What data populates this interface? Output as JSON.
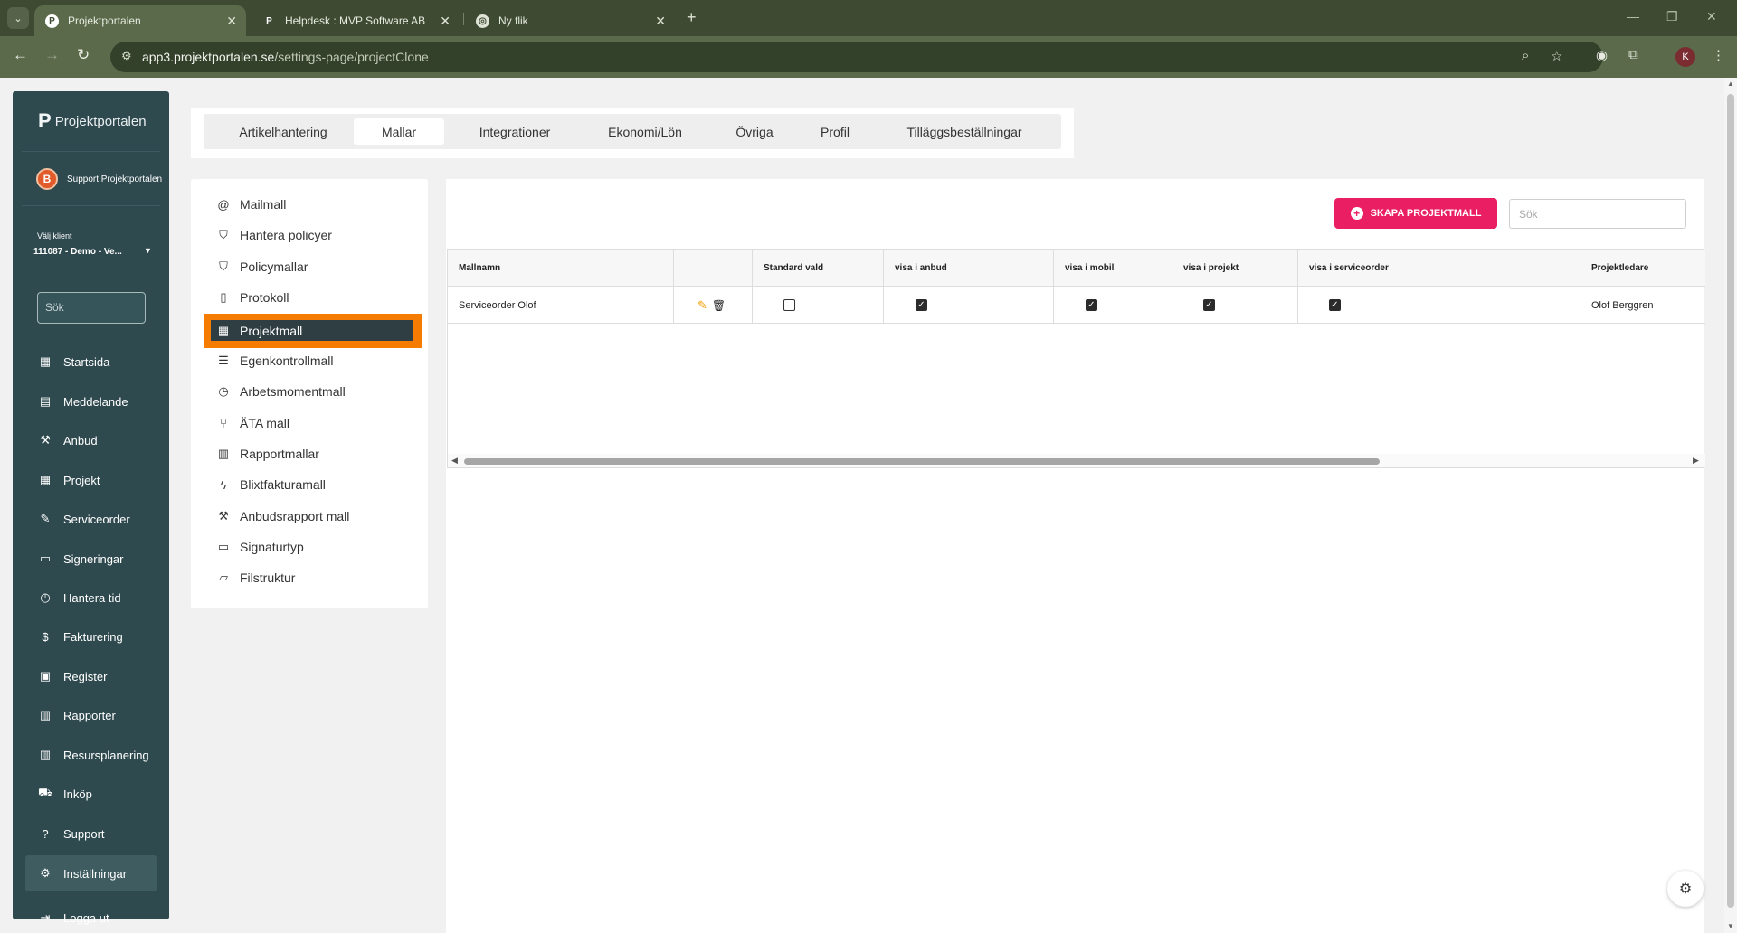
{
  "browser": {
    "tabs": [
      {
        "title": "Projektportalen",
        "active": true
      },
      {
        "title": "Helpdesk : MVP Software AB",
        "active": false
      },
      {
        "title": "Ny flik",
        "active": false
      }
    ],
    "url_host": "app3.projektportalen.se",
    "url_path": "/settings-page/projectClone",
    "profile_initial": "K"
  },
  "sidebar": {
    "brand": "Projektportalen",
    "user_initial": "B",
    "user_name": "Support Projektportalen",
    "client_label": "Välj klient",
    "client_value": "111087 - Demo - Ve...",
    "search_placeholder": "Sök",
    "items": [
      {
        "label": "Startsida",
        "icon": "dashboard-icon"
      },
      {
        "label": "Meddelande",
        "icon": "message-icon"
      },
      {
        "label": "Anbud",
        "icon": "gavel-icon"
      },
      {
        "label": "Projekt",
        "icon": "grid-icon"
      },
      {
        "label": "Serviceorder",
        "icon": "wrench-icon"
      },
      {
        "label": "Signeringar",
        "icon": "signature-icon"
      },
      {
        "label": "Hantera tid",
        "icon": "clock-icon"
      },
      {
        "label": "Fakturering",
        "icon": "dollar-icon"
      },
      {
        "label": "Register",
        "icon": "register-icon"
      },
      {
        "label": "Rapporter",
        "icon": "calendar-icon"
      },
      {
        "label": "Resursplanering",
        "icon": "calendar-icon"
      },
      {
        "label": "Inköp",
        "icon": "cart-icon"
      },
      {
        "label": "Support",
        "icon": "help-icon"
      },
      {
        "label": "Inställningar",
        "icon": "gear-icon",
        "active": true
      }
    ],
    "logout": "Logga ut"
  },
  "top_tabs": [
    "Artikelhantering",
    "Mallar",
    "Integrationer",
    "Ekonomi/Lön",
    "Övriga",
    "Profil",
    "Tilläggsbeställningar"
  ],
  "active_top_tab": "Mallar",
  "template_menu": [
    {
      "label": "Mailmall",
      "icon": "at-icon"
    },
    {
      "label": "Hantera policyer",
      "icon": "shield-icon"
    },
    {
      "label": "Policymallar",
      "icon": "shield-icon"
    },
    {
      "label": "Protokoll",
      "icon": "document-icon"
    },
    {
      "label": "Projektmall",
      "icon": "grid-icon",
      "active": true
    },
    {
      "label": "Egenkontrollmall",
      "icon": "checklist-icon"
    },
    {
      "label": "Arbetsmomentmall",
      "icon": "clock-icon"
    },
    {
      "label": "ÄTA mall",
      "icon": "branch-icon"
    },
    {
      "label": "Rapportmallar",
      "icon": "calendar-icon"
    },
    {
      "label": "Blixtfakturamall",
      "icon": "lightning-icon"
    },
    {
      "label": "Anbudsrapport mall",
      "icon": "gavel-icon"
    },
    {
      "label": "Signaturtyp",
      "icon": "signature-icon"
    },
    {
      "label": "Filstruktur",
      "icon": "folder-icon"
    }
  ],
  "content": {
    "create_button": "SKAPA PROJEKTMALL",
    "search_placeholder": "Sök",
    "columns": [
      "Mallnamn",
      "",
      "Standard vald",
      "visa i anbud",
      "visa i mobil",
      "visa i projekt",
      "visa i serviceorder",
      "Projektledare"
    ],
    "rows": [
      {
        "name": "Serviceorder Olof",
        "standard_vald": false,
        "visa_i_anbud": true,
        "visa_i_mobil": true,
        "visa_i_projekt": true,
        "visa_i_serviceorder": true,
        "projektledare": "Olof Berggren"
      }
    ]
  },
  "colors": {
    "sidebar_bg": "#2f4a4f",
    "accent_pink": "#e91e63",
    "highlight_orange": "#f57c00",
    "chrome_bg": "#3e4a32"
  }
}
